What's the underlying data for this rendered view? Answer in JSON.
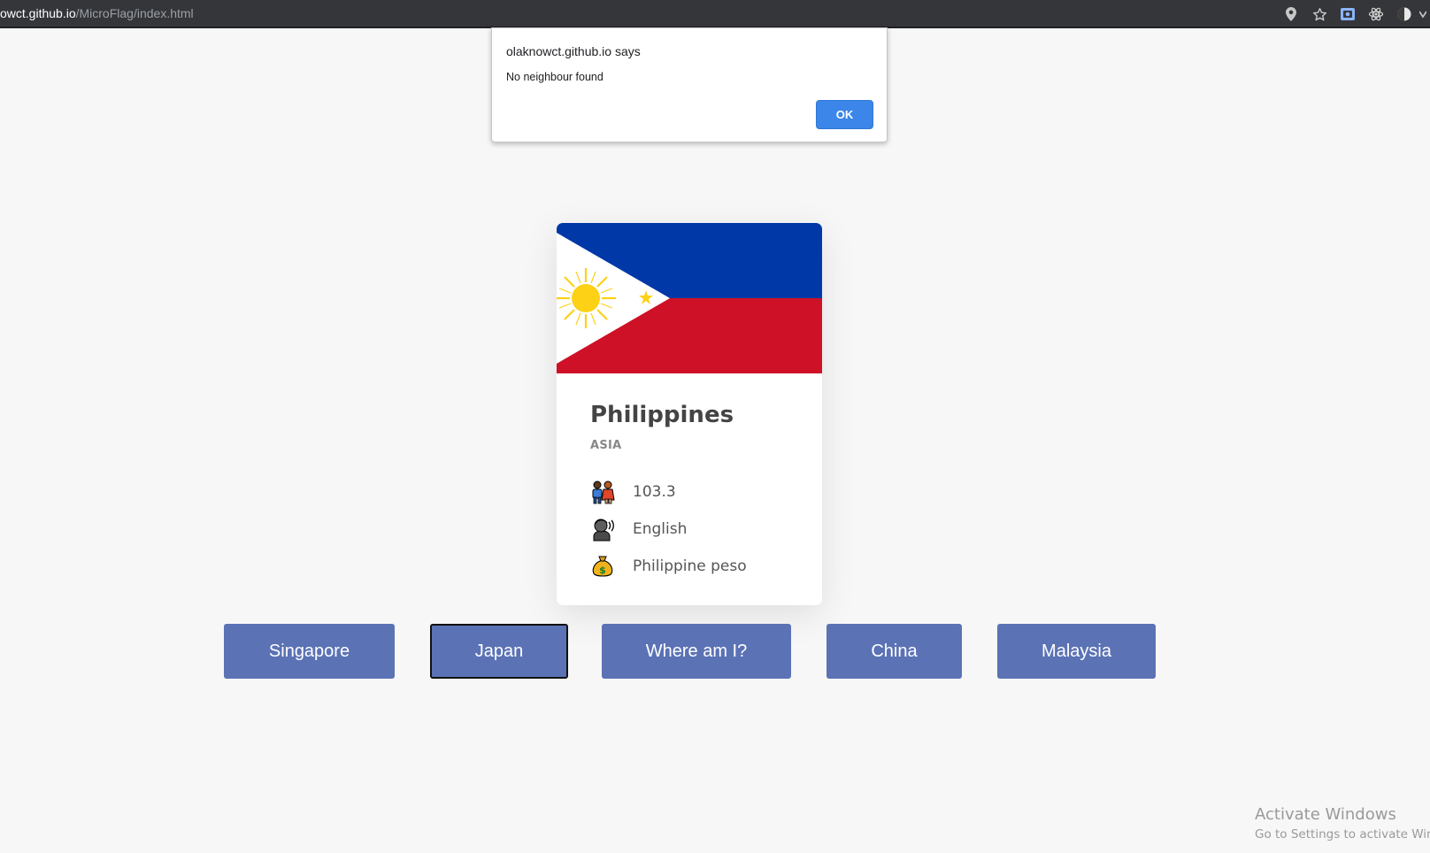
{
  "browser": {
    "url_host": "owct.github.io",
    "url_path": "/MicroFlag/index.html",
    "icons": [
      "location-icon",
      "star-icon",
      "extension-icon",
      "react-icon",
      "profile-icon"
    ]
  },
  "dialog": {
    "title": "olaknowct.github.io says",
    "message": "No neighbour found",
    "ok_label": "OK"
  },
  "card": {
    "country": "Philippines",
    "region": "ASIA",
    "population": "103.3",
    "language": "English",
    "currency": "Philippine peso",
    "flag_colors": {
      "blue": "#0038a8",
      "red": "#ce1126",
      "white": "#ffffff",
      "yellow": "#fcd116"
    },
    "icons": [
      "people-icon",
      "speaking-head-icon",
      "money-bag-icon"
    ]
  },
  "buttons": [
    "Singapore",
    "Japan",
    "Where am I?",
    "China",
    "Malaysia"
  ],
  "watermark": {
    "title": "Activate Windows",
    "subtitle": "Go to Settings to activate Win"
  },
  "colors": {
    "button": "#5b72b5",
    "page_background": "#f7f7f7",
    "dialog_ok": "#3b86e8"
  }
}
